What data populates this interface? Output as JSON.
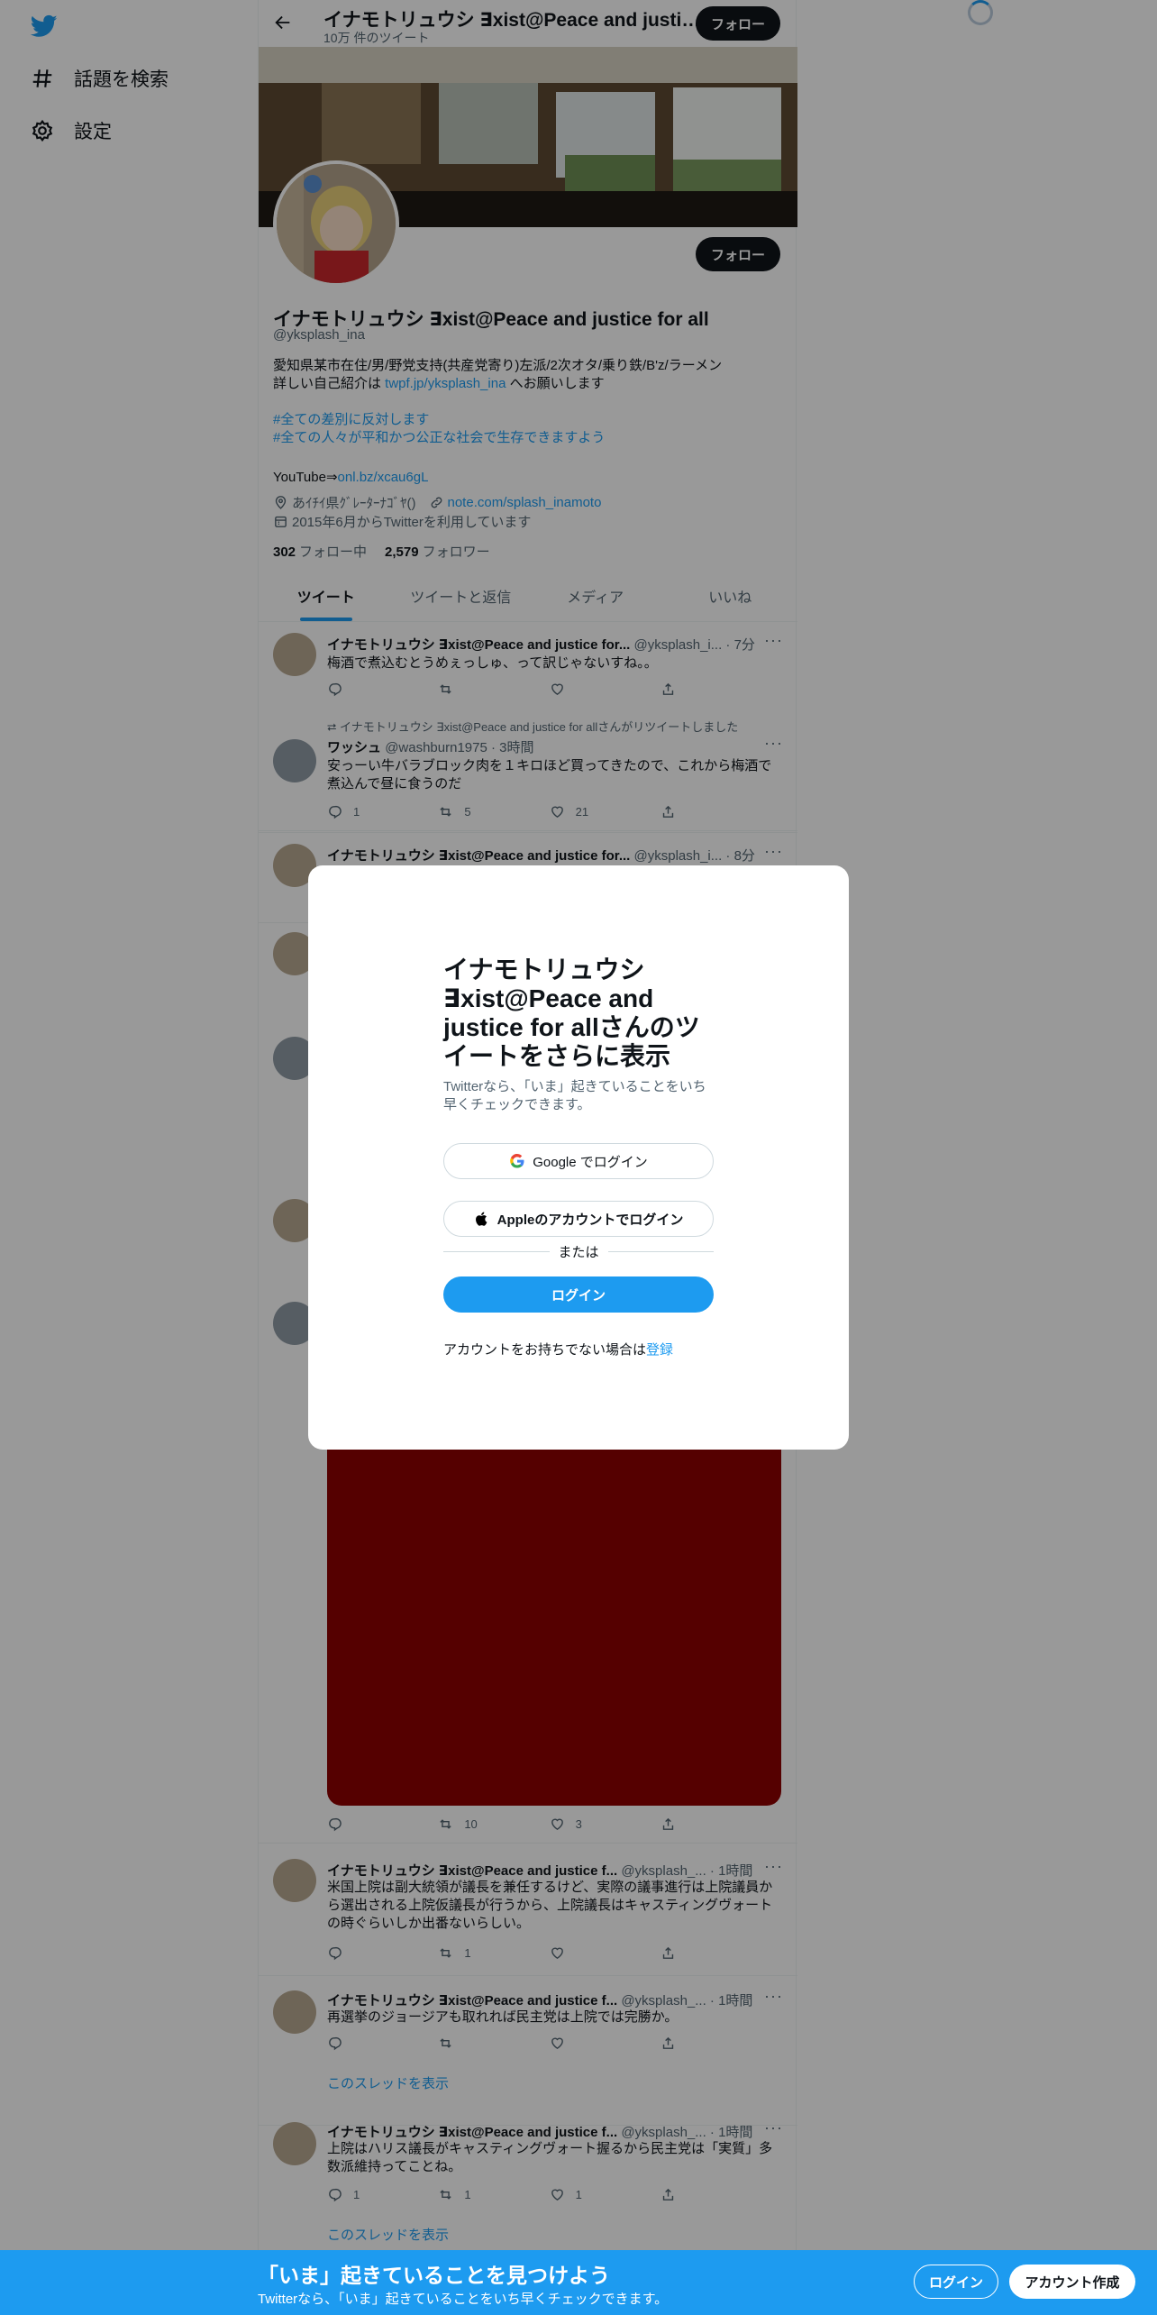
{
  "nav": {
    "explore_label": "話題を検索",
    "settings_label": "設定"
  },
  "header": {
    "name": "イナモトリュウシ ∃xist@Peace and justice for all",
    "tweet_count": "10万 件のツイート",
    "follow_label": "フォロー"
  },
  "profile": {
    "follow_label": "フォロー",
    "name": "イナモトリュウシ ∃xist@Peace and justice for all",
    "handle": "@yksplash_ina",
    "bio_line1": "愛知県某市在住/男/野党支持(共産党寄り)左派/2次オタ/乗り鉄/B'z/ラーメン",
    "bio_line2_pre": "詳しい自己紹介は ",
    "bio_line2_link": "twpf.jp/yksplash_ina",
    "bio_line2_post": " へお願いします",
    "hashtag1": "#全ての差別に反対します",
    "hashtag2": "#全ての人々が平和かつ公正な社会で生存できますよう",
    "youtube_pre": "YouTube⇒",
    "youtube_link": "onl.bz/xcau6gL",
    "location": "あｲﾁｲ県ｸﾞﾚｰﾀｰﾅｺﾞﾔ()",
    "website": "note.com/splash_inamoto",
    "joined": "2015年6月からTwitterを利用しています",
    "following_count": "302",
    "following_label": "フォロー中",
    "followers_count": "2,579",
    "followers_label": "フォロワー"
  },
  "tabs": [
    "ツイート",
    "ツイートと返信",
    "メディア",
    "いいね"
  ],
  "tweets": [
    {
      "name": "イナモトリュウシ ∃xist@Peace and justice for...",
      "meta": "@yksplash_i... · 7分",
      "text": "梅酒で煮込むとうめぇっしゅ、って訳じゃないすね。。",
      "replies": "",
      "retweets": "",
      "likes": ""
    },
    {
      "retweet_note": "イナモトリュウシ ∃xist@Peace and justice for allさんがリツイートしました",
      "name": "ワッシュ",
      "meta": "@washburn1975 · 3時間",
      "text": "安っーい牛バラブロック肉を１キロほど買ってきたので、これから梅酒で煮込んで昼に食うのだ",
      "replies": "1",
      "retweets": "5",
      "likes": "21"
    },
    {
      "name": "イナモトリュウシ ∃xist@Peace and justice for...",
      "meta": "@yksplash_i... · 8分"
    },
    {
      "replies": "",
      "retweets": "10",
      "likes": "3"
    },
    {
      "name": "イナモトリュウシ ∃xist@Peace and justice f...",
      "meta": "@yksplash_... · 1時間",
      "text": "米国上院は副大統領が議長を兼任するけど、実際の議事進行は上院議員から選出される上院仮議長が行うから、上院議長はキャスティングヴォートの時ぐらいしか出番ないらしい。",
      "replies": "",
      "retweets": "1",
      "likes": ""
    },
    {
      "name": "イナモトリュウシ ∃xist@Peace and justice f...",
      "meta": "@yksplash_... · 1時間",
      "text": "再選挙のジョージアも取れれば民主党は上院では完勝か。",
      "replies": "",
      "retweets": "",
      "likes": "",
      "thread": "このスレッドを表示"
    },
    {
      "name": "イナモトリュウシ ∃xist@Peace and justice f...",
      "meta": "@yksplash_... · 1時間",
      "text": "上院はハリス議長がキャスティングヴォート握るから民主党は「実質」多数派維持ってことね。",
      "replies": "1",
      "retweets": "1",
      "likes": "1",
      "thread": "このスレッドを表示"
    }
  ],
  "modal": {
    "title": "イナモトリュウシ ∃xist@Peace and justice for allさんのツイートをさらに表示",
    "subtitle": "Twitterなら、「いま」起きていることをいち早くチェックできます。",
    "google_label": "Google でログイン",
    "apple_label": "Appleのアカウントでログイン",
    "or_label": "または",
    "login_label": "ログイン",
    "signup_prompt": "アカウントをお持ちでない場合は",
    "signup_link": "登録"
  },
  "bottom_bar": {
    "title": "「いま」起きていることを見つけよう",
    "subtitle": "Twitterなら、「いま」起きていることをいち早くチェックできます。",
    "login_label": "ログイン",
    "signup_label": "アカウント作成"
  },
  "colors": {
    "accent": "#1d9bf0",
    "text": "#0f1419",
    "secondary": "#536471",
    "media_red": "#8e0000"
  }
}
